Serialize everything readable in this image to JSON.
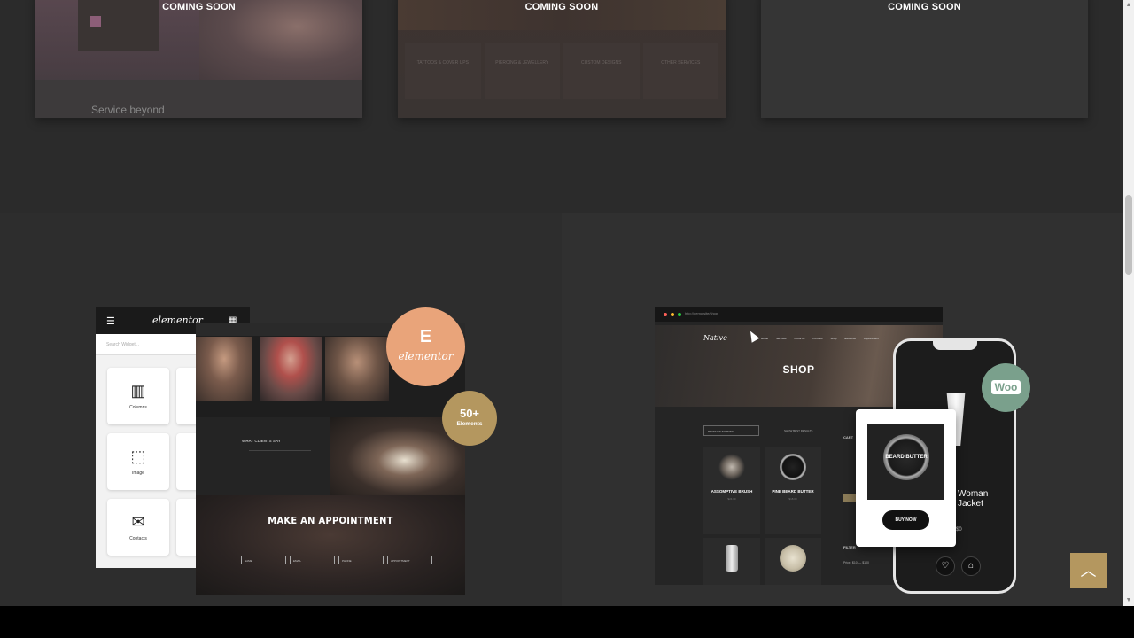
{
  "top_cards": [
    {
      "label": "COMING SOON",
      "caption": "Service beyond"
    },
    {
      "label": "COMING SOON",
      "cells": [
        "TATTOOS & COVER UPS",
        "PIERCING & JEWELLERY",
        "CUSTOM DESIGNS",
        "OTHER SERVICES"
      ]
    },
    {
      "label": "COMING SOON"
    }
  ],
  "elementor": {
    "logo": "elementor",
    "search_placeholder": "Search Widget...",
    "widgets": [
      "Columns",
      "Image",
      "Contacts"
    ],
    "badge_word": "elementor",
    "count_number": "50+",
    "count_label": "Elements",
    "testimonial_title": "WHAT CLIENTS SAY",
    "appointment_title": "MAKE AN APPOINTMENT",
    "fields": [
      "NAME",
      "EMAIL",
      "PHONE",
      "APPOINTMENT"
    ]
  },
  "shop": {
    "url": "http://demo.site/shop",
    "brand": "Native",
    "nav": [
      "Home",
      "Services",
      "About us",
      "Portfolio",
      "Shop",
      "Elements",
      "Appointment"
    ],
    "title": "SHOP",
    "filter_button": "PRODUCT SORTING",
    "sort_label": "SHOW BEST RESULTS",
    "products": [
      {
        "name": "ASSOMPTIVE BRUSH",
        "price": "$24.00"
      },
      {
        "name": "PINE BEARD BUTTER",
        "price": "$18.00"
      }
    ],
    "sidebar_title": "CART",
    "filter_title": "FILTER",
    "price_range": "Price: $10 — $100",
    "woo_label": "Woo",
    "popup_product": "BEARD BUTTER",
    "popup_button": "BUY NOW",
    "phone_title": "Woman Jacket",
    "phone_price": "$0"
  },
  "scroll_top_icon": "chevron-up-icon"
}
